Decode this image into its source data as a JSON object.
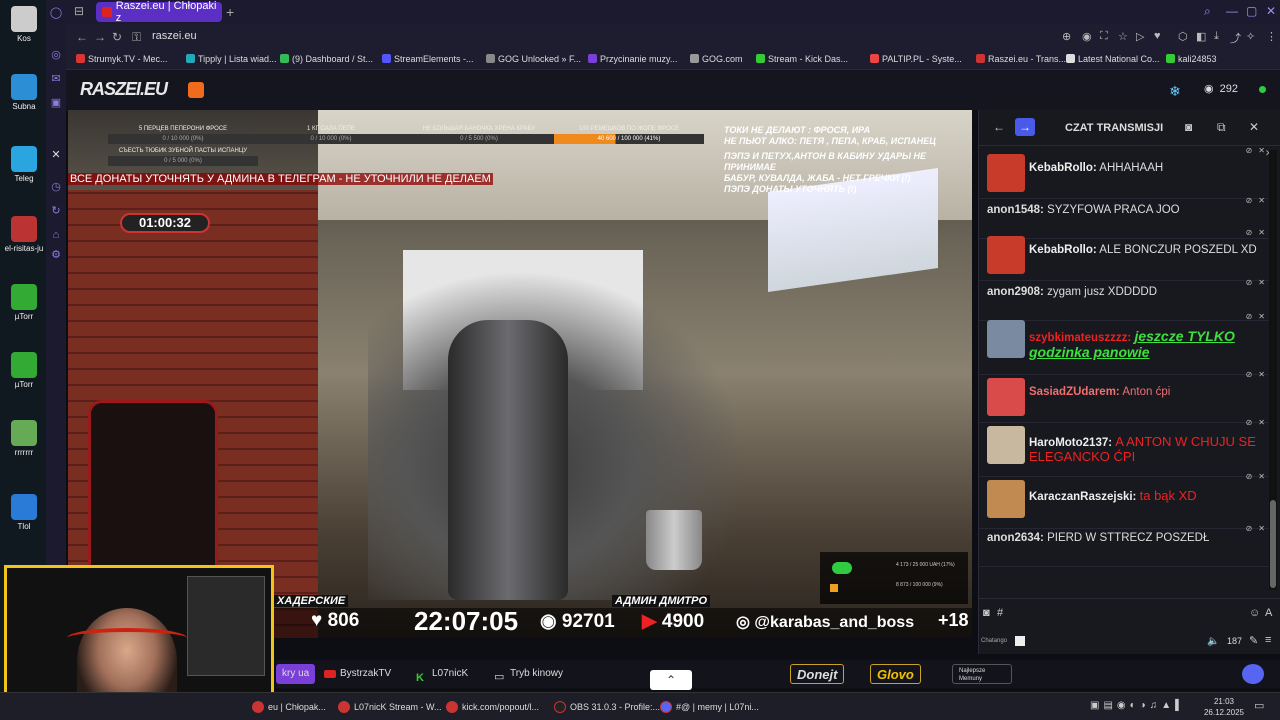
{
  "browser": {
    "tab_title": "Raszei.eu | Chłopaki z",
    "url": "raszei.eu",
    "bookmarks": [
      {
        "label": "Strumyk.TV - Mec...",
        "color": "#d33"
      },
      {
        "label": "Tipply | Lista wiad...",
        "color": "#2ab"
      },
      {
        "label": "(9) Dashboard / St...",
        "color": "#3b5"
      },
      {
        "label": "StreamElements -...",
        "color": "#55f"
      },
      {
        "label": "GOG Unlocked » F...",
        "color": "#888"
      },
      {
        "label": "Przycinanie muzy...",
        "color": "#7a3fd8"
      },
      {
        "label": "GOG.com",
        "color": "#999"
      },
      {
        "label": "Stream - Kick Das...",
        "color": "#3c3"
      },
      {
        "label": "PALTIP.PL - Syste...",
        "color": "#e44"
      },
      {
        "label": "Raszei.eu - Trans...",
        "color": "#c33"
      },
      {
        "label": "Latest National Co...",
        "color": "#ddd"
      },
      {
        "label": "kali24853",
        "color": "#3c3"
      }
    ]
  },
  "desktop": {
    "icons": [
      "Kos",
      "Subna",
      "Teleg",
      "el-risitas-ju",
      "µTorr",
      "µTorr",
      "rrrrrrr",
      "Tlol"
    ]
  },
  "site": {
    "logo": "RASZEI.EU",
    "viewer_count": "292"
  },
  "video": {
    "goals": [
      {
        "title": "5 ПЕРЦЕВ ПЕПЕРОНИ ФРОСЕ",
        "value": "0 / 10 000 (0%)"
      },
      {
        "title": "1 КГ САЛА ПЕПЕ",
        "value": "0 / 10 000 (0%)"
      },
      {
        "title": "НЕ БОЛЬШАЯ БАНОЧКА ХРЕНА КРАБУ",
        "value": "0 / 5 500 (0%)"
      },
      {
        "title": "100 РЕМЕШКОВ ПО ЖОПЕ ФРОСЕ",
        "value": "40 600 / 100 000 (41%)"
      }
    ],
    "goal_extra": {
      "title": "СЪЕСТЬ ТЮБИК ЗУБНОЙ ПАСТЫ ИСПАНЦУ",
      "value": "0 / 5 000 (0%)"
    },
    "banner": "ВСЕ ДОНАТЫ УТОЧНЯТЬ У АДМИНА В ТЕЛЕГРАМ - НЕ УТОЧНИЛИ НЕ ДЕЛАЕМ",
    "rules": [
      "ТОКИ НЕ ДЕЛАЮТ : ФРОСЯ, ИРА",
      "НЕ ПЬЮТ АЛКО: ПЕТЯ , ПЕПА, КРАБ, ИСПАНЕЦ",
      "",
      "ПЭПЭ И ПЕТУХ,АНТОН В КАБИНУ УДАРЫ НЕ ПРИНИМАЕ",
      "БАБУР, КУВАЛДА, ЖАБА - НЕТ ГРЕЧКИ (!)",
      "ПЭПЭ ДОНАТЫ УТОЧНЯТЬ (!)"
    ],
    "timer": "01:00:32",
    "name_left": "ХАДЕРСКИЕ",
    "name_right": "АДМИН ДМИТРО",
    "likes": "806",
    "clock": "22:07:05",
    "views": "92701",
    "subs": "4900",
    "instagram": "@karabas_and_boss",
    "age": "+18",
    "mini_goal_1": "4 173 / 25 000 UAH (17%)",
    "mini_goal_2": "8 873 / 100 000 (9%)"
  },
  "chat": {
    "title": "CZAT TRANSMISJI",
    "messages": [
      {
        "user": "KebabRollo:",
        "text": "AHHAHAAH",
        "avatar": true,
        "color": "#eee",
        "text_color": "#ddd"
      },
      {
        "user": "anon1548:",
        "text": "SYZYFOWA PRACA JOO",
        "avatar": false,
        "color": "#ddd",
        "text_color": "#ddd"
      },
      {
        "user": "KebabRollo:",
        "text": "ALE BONCZUR POSZEDL XD",
        "avatar": true,
        "color": "#eee",
        "text_color": "#ddd"
      },
      {
        "user": "anon2908:",
        "text": "zygam jusz XDDDDD",
        "avatar": false,
        "color": "#ddd",
        "text_color": "#ddd"
      },
      {
        "user": "szybkimateuszzzz:",
        "text": "jeszcze TYLKO godzinka panowie",
        "avatar": true,
        "color": "#e22",
        "text_color": "#3de03d"
      },
      {
        "user": "SasiadZUdarem:",
        "text": "Anton ćpi",
        "avatar": true,
        "color": "#f07070",
        "text_color": "#f07070"
      },
      {
        "user": "HaroMoto2137:",
        "text": "A ANTON W CHUJU SE ELEGANCKO ĆPI",
        "avatar": true,
        "color": "#eee",
        "text_color": "#e22"
      },
      {
        "user": "KaraczanRaszejski:",
        "text": "ta bąk XD",
        "avatar": true,
        "color": "#eee",
        "text_color": "#e22"
      },
      {
        "user": "anon2634:",
        "text": "PIERD W STTRECZ POSZEDŁ",
        "avatar": false,
        "color": "#ddd",
        "text_color": "#ddd"
      }
    ],
    "input_hash": "#",
    "footer_label": "Chatango",
    "footer_count": "187"
  },
  "pagebar": {
    "items": [
      "kry ua",
      "BystrzakTV",
      "L07nicK",
      "Tryb kinowy"
    ],
    "donate": "Donejt",
    "glovo": "Glovo",
    "memy": "Najlepsze Memuny"
  },
  "taskbar": {
    "items": [
      {
        "label": "eu | Chłopak...",
        "color": "#c33"
      },
      {
        "label": "L07nicK Stream - W...",
        "color": "#c33"
      },
      {
        "label": "kick.com/popout/l...",
        "color": "#c33"
      },
      {
        "label": "OBS 31.0.3 - Profile:...",
        "color": "#222"
      },
      {
        "label": "#@ | memy | L07ni...",
        "color": "#5865f2"
      }
    ],
    "time": "21:03",
    "date": "26.12.2025"
  }
}
